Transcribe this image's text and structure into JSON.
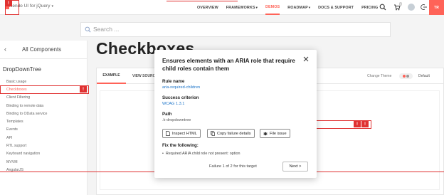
{
  "header": {
    "brand_text": "Kendo UI for jQuery",
    "nav": [
      {
        "label": "OVERVIEW",
        "caret": false,
        "active": false
      },
      {
        "label": "FRAMEWORKS",
        "caret": true,
        "active": false
      },
      {
        "label": "DEMOS",
        "caret": false,
        "active": true
      },
      {
        "label": "ROADMAP",
        "caret": true,
        "active": false
      },
      {
        "label": "DOCS & SUPPORT",
        "caret": false,
        "active": false
      },
      {
        "label": "PRICING",
        "caret": false,
        "active": false
      }
    ],
    "cart_count": "0",
    "trial_label": "TR",
    "icons": [
      "search-icon",
      "cart-icon",
      "avatar",
      "logout-icon"
    ]
  },
  "search": {
    "placeholder": "Search ..."
  },
  "sidebar": {
    "back_label": "All Components",
    "section_title": "DropDownTree",
    "items": [
      {
        "label": "Basic usage",
        "active": false
      },
      {
        "label": "Checkboxes",
        "active": true
      },
      {
        "label": "Client Filtering",
        "active": false
      },
      {
        "label": "Binding to remote data",
        "active": false
      },
      {
        "label": "Binding to OData service",
        "active": false
      },
      {
        "label": "Templates",
        "active": false
      },
      {
        "label": "Events",
        "active": false
      },
      {
        "label": "API",
        "active": false
      },
      {
        "label": "RTL support",
        "active": false
      },
      {
        "label": "Keyboard navigation",
        "active": false
      },
      {
        "label": "MVVM",
        "active": false
      },
      {
        "label": "AngularJS",
        "active": false
      }
    ]
  },
  "main": {
    "page_title": "Checkboxes",
    "tabs": [
      {
        "label": "EXAMPLE",
        "active": true
      },
      {
        "label": "VIEW SOURCE",
        "active": false
      }
    ],
    "theme_label": "Change Theme",
    "theme_value": "Default"
  },
  "overlay": {
    "marker_symbol": "!"
  },
  "modal": {
    "title": "Ensures elements with an ARIA role that require child roles contain them",
    "rule_name_label": "Rule name",
    "rule_name_value": "aria-required-children",
    "success_label": "Success criterion",
    "success_value": "WCAG 1.3.1",
    "path_label": "Path",
    "path_value": ".k-dropdowntree",
    "buttons": {
      "inspect": "Inspect HTML",
      "copy": "Copy failure details",
      "file": "File issue"
    },
    "fix_label": "Fix the following:",
    "fix_items": [
      "Required ARIA child role not present: option"
    ],
    "counter_text": "Failure 1 of 2 for this target",
    "next_label": "Next >"
  },
  "colors": {
    "accent": "#ff6358",
    "link": "#1a73c9",
    "issue_marker": "#e03131"
  }
}
